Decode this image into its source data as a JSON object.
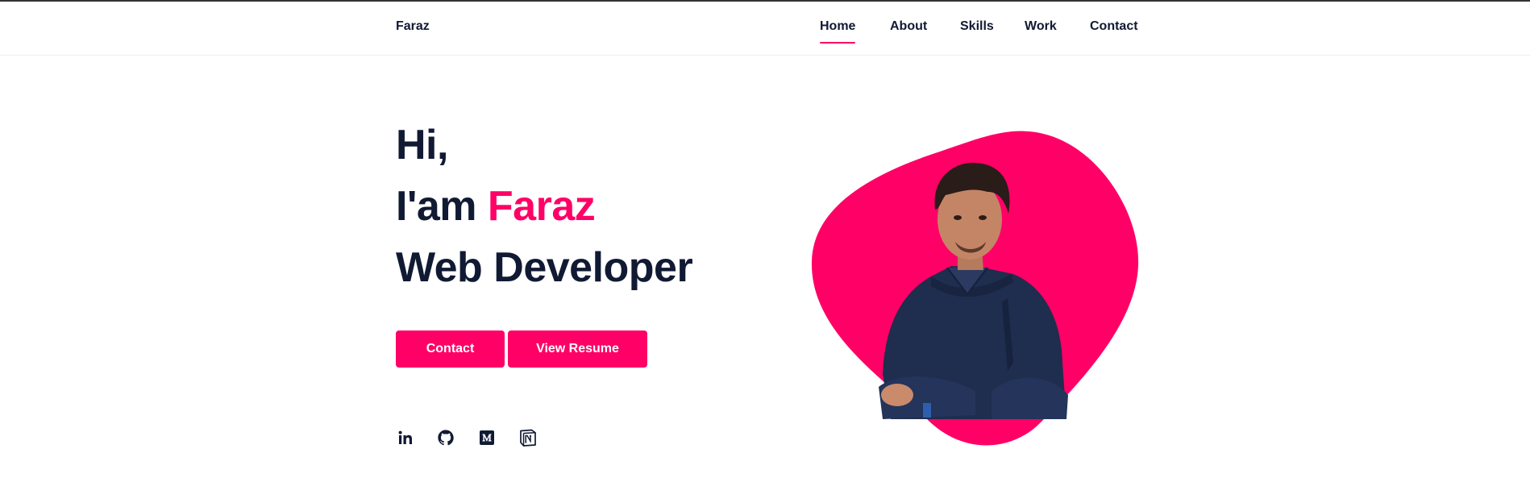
{
  "header": {
    "brand": "Faraz",
    "nav": [
      {
        "label": "Home",
        "active": true
      },
      {
        "label": "About",
        "active": false
      },
      {
        "label": "Skills",
        "active": false
      },
      {
        "label": "Work",
        "active": false
      },
      {
        "label": "Contact",
        "active": false
      }
    ]
  },
  "hero": {
    "line1": "Hi,",
    "line2_prefix": "I'am ",
    "line2_name": "Faraz",
    "line3": "Web Developer",
    "buttons": {
      "contact": "Contact",
      "resume": "View Resume"
    },
    "socials": [
      "linkedin-icon",
      "github-icon",
      "medium-icon",
      "notion-icon"
    ]
  },
  "colors": {
    "accent": "#ff0066",
    "text": "#111a33",
    "background": "#ffffff"
  }
}
